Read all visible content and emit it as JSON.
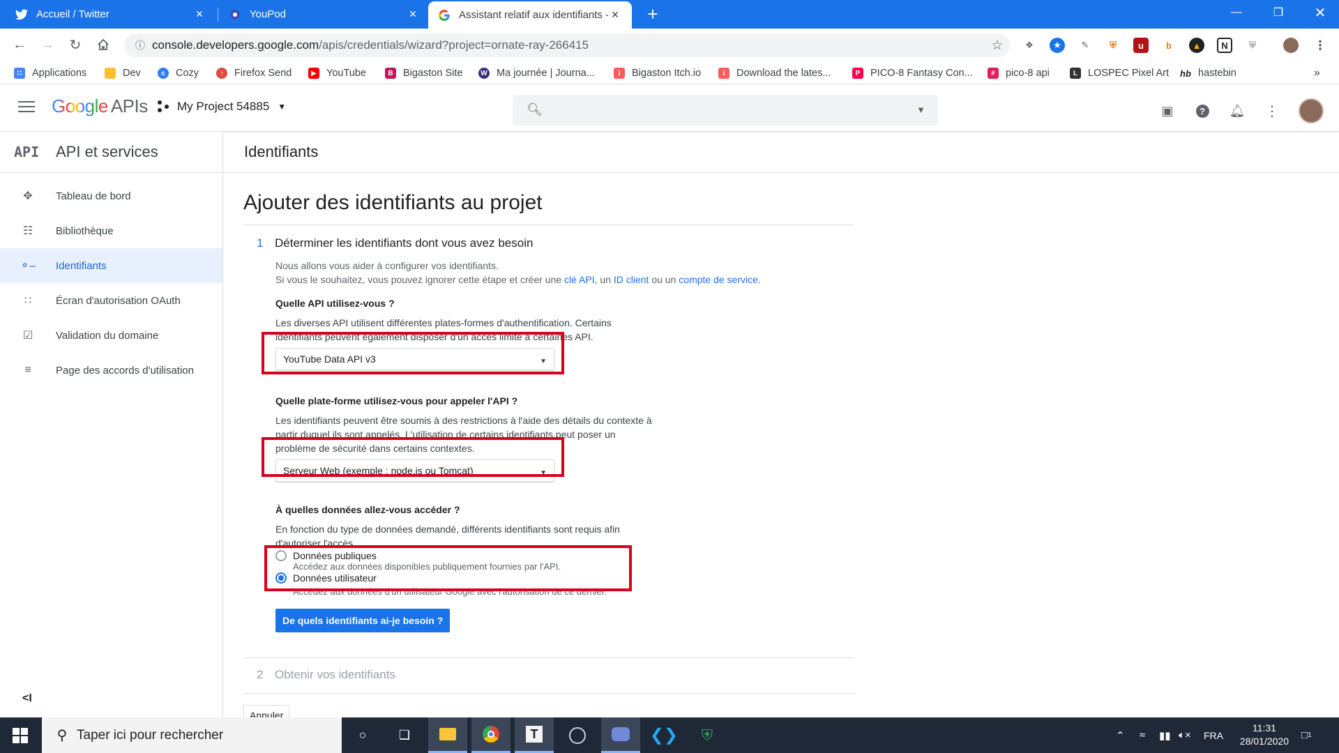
{
  "browser": {
    "tabs": [
      {
        "title": "Accueil / Twitter",
        "icon": "twitter-icon",
        "active": false
      },
      {
        "title": "YouPod",
        "icon": "youpod-icon",
        "active": false
      },
      {
        "title": "Assistant relatif aux identifiants -",
        "icon": "google-icon",
        "active": true
      }
    ],
    "url_host": "console.developers.google.com",
    "url_path": "/apis/credentials/wizard?project=ornate-ray-266415",
    "bookmarks": [
      {
        "label": "Applications",
        "icon": "apps-grid-icon",
        "color": "#4285f4"
      },
      {
        "label": "Dev",
        "icon": "folder-icon",
        "color": "#fbc02d"
      },
      {
        "label": "Cozy",
        "icon": "cozy-icon",
        "color": "#297ef2"
      },
      {
        "label": "Firefox Send",
        "icon": "firefox-send-icon",
        "color": "#e04a3f"
      },
      {
        "label": "YouTube",
        "icon": "youtube-icon",
        "color": "#ff0000"
      },
      {
        "label": "Bigaston Site",
        "icon": "bigaston-icon",
        "color": "#c2185b"
      },
      {
        "label": "Ma journée | Journa...",
        "icon": "journal-icon",
        "color": "#3b2c80"
      },
      {
        "label": "Bigaston Itch.io",
        "icon": "itchio-icon",
        "color": "#fa5c5c"
      },
      {
        "label": "Download the lates...",
        "icon": "itchio-icon",
        "color": "#fa5c5c"
      },
      {
        "label": "PICO-8 Fantasy Con...",
        "icon": "pico8-icon",
        "color": "#ff004d"
      },
      {
        "label": "pico-8 api",
        "icon": "slack-icon",
        "color": "#e01e5a"
      },
      {
        "label": "LOSPEC Pixel Art",
        "icon": "lospec-icon",
        "color": "#333333"
      },
      {
        "label": "hastebin",
        "icon": "hastebin-icon",
        "color": "#202124"
      }
    ]
  },
  "console": {
    "logo_google": "Google",
    "logo_apis": "APIs",
    "project_name": "My Project 54885",
    "sidebar_abbr": "API",
    "sidebar_title": "API et services",
    "nav": [
      {
        "label": "Tableau de bord",
        "icon": "dashboard-icon",
        "active": false
      },
      {
        "label": "Bibliothèque",
        "icon": "library-icon",
        "active": false
      },
      {
        "label": "Identifiants",
        "icon": "key-icon",
        "active": true
      },
      {
        "label": "Écran d'autorisation OAuth",
        "icon": "oauth-consent-icon",
        "active": false
      },
      {
        "label": "Validation du domaine",
        "icon": "domain-verification-icon",
        "active": false
      },
      {
        "label": "Page des accords d'utilisation",
        "icon": "agreements-icon",
        "active": false
      }
    ],
    "page_header": "Identifiants"
  },
  "wizard": {
    "title": "Ajouter des identifiants au projet",
    "step1_num": "1",
    "step1_title": "Déterminer les identifiants dont vous avez besoin",
    "intro_line1": "Nous allons vous aider à configurer vos identifiants.",
    "intro_line2_pre": "Si vous le souhaitez, vous pouvez ignorer cette étape et créer une ",
    "link_api_key": "clé API",
    "sep1": ", un ",
    "link_client_id": "ID client",
    "sep2": " ou un ",
    "link_service_account": "compte de service",
    "intro_end": ".",
    "q1": "Quelle API utilisez-vous ?",
    "q1_desc": "Les diverses API utilisent différentes plates-formes d'authentification. Certains identifiants peuvent également disposer d'un accès limité à certaines API.",
    "q1_value": "YouTube Data API v3",
    "q2": "Quelle plate-forme utilisez-vous pour appeler l'API ?",
    "q2_desc": "Les identifiants peuvent être soumis à des restrictions à l'aide des détails du contexte à partir duquel ils sont appelés. L'utilisation de certains identifiants peut poser un problème de sécurité dans certains contextes.",
    "q2_value": "Serveur Web (exemple : node.js ou Tomcat)",
    "q3": "À quelles données allez-vous accéder ?",
    "q3_desc": "En fonction du type de données demandé, différents identifiants sont requis afin d'autoriser l'accès.",
    "opt_public": "Données publiques",
    "opt_public_sub": "Accédez aux données disponibles publiquement fournies par l'API.",
    "opt_user": "Données utilisateur",
    "opt_user_sub": "Accédez aux données d'un utilisateur Google avec l'autorisation de ce dernier.",
    "selected_option": "Données utilisateur",
    "cta": "De quels identifiants ai-je besoin ?",
    "step2_num": "2",
    "step2_title": "Obtenir vos identifiants",
    "cancel": "Annuler"
  },
  "taskbar": {
    "search_placeholder": "Taper ici pour rechercher",
    "language": "FRA",
    "time": "11:31",
    "date": "28/01/2020",
    "notification_count": "1"
  },
  "colors": {
    "accent": "#1a73e8",
    "highlight_box": "#d9001b"
  }
}
